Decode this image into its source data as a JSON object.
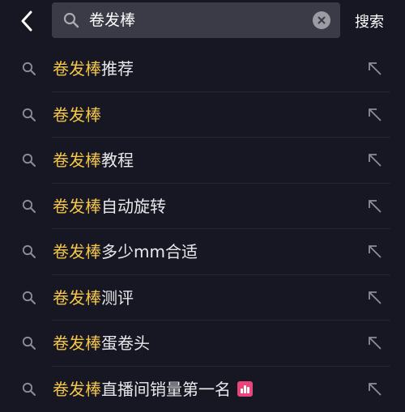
{
  "header": {
    "query": "卷发棒",
    "search_label": "搜索"
  },
  "suggestions": [
    {
      "highlight": "卷发棒",
      "rest": "推荐"
    },
    {
      "highlight": "卷发棒",
      "rest": ""
    },
    {
      "highlight": "卷发棒",
      "rest": "教程"
    },
    {
      "highlight": "卷发棒",
      "rest": "自动旋转"
    },
    {
      "highlight": "卷发棒",
      "rest": "多少mm合适"
    },
    {
      "highlight": "卷发棒",
      "rest": "测评"
    },
    {
      "highlight": "卷发棒",
      "rest": "蛋卷头"
    },
    {
      "highlight": "卷发棒",
      "rest": "直播间销量第一名",
      "badge": "hot-chart-icon"
    }
  ],
  "colors": {
    "background": "#161722",
    "highlight": "#f4c64a",
    "search_box": "#3a3b46",
    "badge": "#e8457a"
  }
}
